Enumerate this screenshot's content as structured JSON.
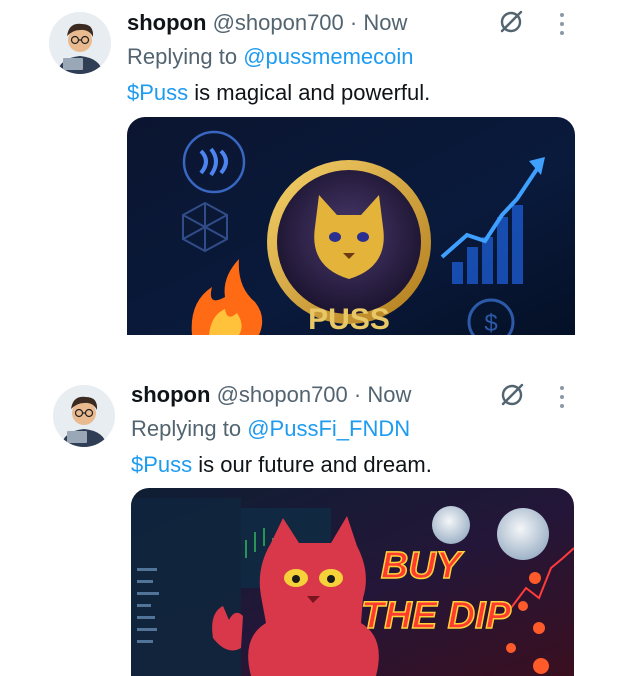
{
  "tweets": [
    {
      "name": "shopon",
      "handle": "@shopon700",
      "separator": "·",
      "time": "Now",
      "replying_prefix": "Replying to",
      "replying_to": "@pussmemecoin",
      "cashtag": "$Puss",
      "text_rest": " is magical and powerful.",
      "image_text": "PUSS"
    },
    {
      "name": "shopon",
      "handle": "@shopon700",
      "separator": "·",
      "time": "Now",
      "replying_prefix": "Replying to",
      "replying_to": "@PussFi_FNDN",
      "cashtag": "$Puss",
      "text_rest": " is our future and dream.",
      "image_text_line1": "BUY",
      "image_text_line2": "THE DIP"
    }
  ],
  "colors": {
    "link": "#1d9bf0",
    "secondary": "#536471",
    "primary": "#0f1419"
  }
}
